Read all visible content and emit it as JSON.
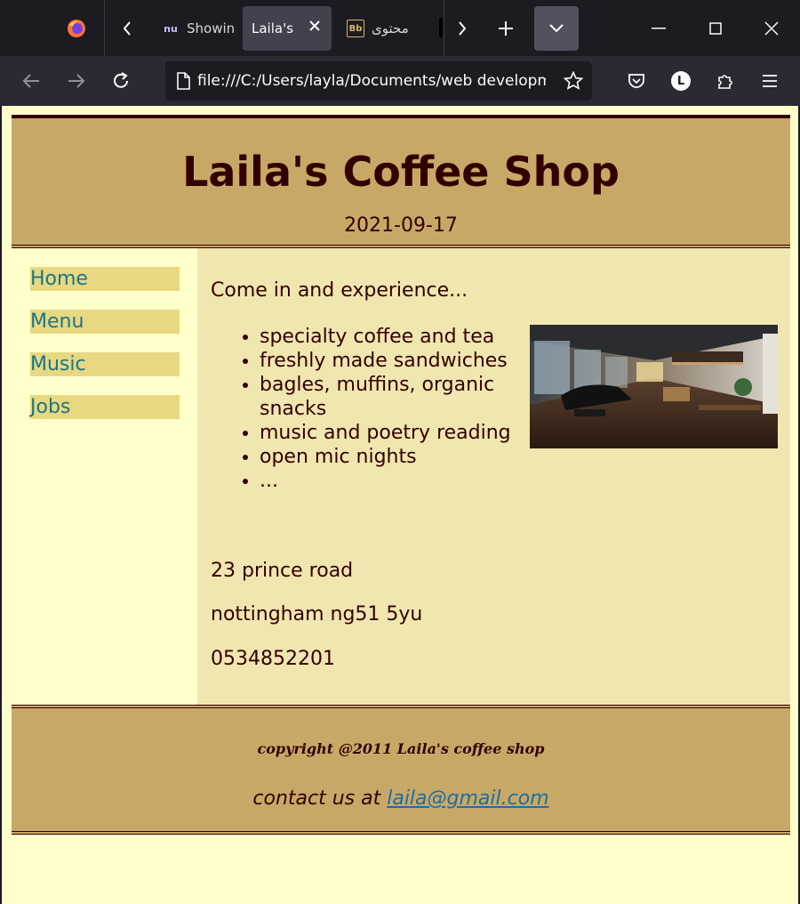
{
  "browser": {
    "tabs": [
      {
        "label": "Showin",
        "favicon": "nu"
      },
      {
        "label": "Laila's C",
        "favicon": "",
        "active": true
      },
      {
        "label": "محتوى",
        "favicon": "Bb"
      }
    ],
    "url": "file:///C:/Users/layla/Documents/web developme",
    "profile_initial": "L",
    "colors": {
      "chrome_dark": "#1c1b22",
      "toolbar": "#2b2a33",
      "active_tab": "#42414d"
    }
  },
  "site": {
    "title": "Laila's Coffee Shop",
    "date": "2021-09-17",
    "nav": [
      "Home",
      "Menu",
      "Music",
      "Jobs"
    ],
    "intro": "Come in and experience...",
    "features": [
      "specialty coffee and tea",
      "freshly made sandwiches",
      "bagles, muffins, organic snacks",
      "music and poetry reading",
      "open mic nights",
      "..."
    ],
    "address_line1": "23 prince road",
    "address_line2": "nottingham ng51 5yu",
    "phone": "0534852201",
    "copyright": "copyright @2011 Laila's coffee shop",
    "contact_prefix": "contact us at ",
    "contact_email": "laila@gmail.com",
    "colors": {
      "header_bg": "#c8a867",
      "text_dark": "#330000",
      "page_bg": "#ffffcc",
      "content_bg": "#f0e6b0",
      "nav_bg": "#e8d882",
      "link": "#1a7687"
    }
  }
}
